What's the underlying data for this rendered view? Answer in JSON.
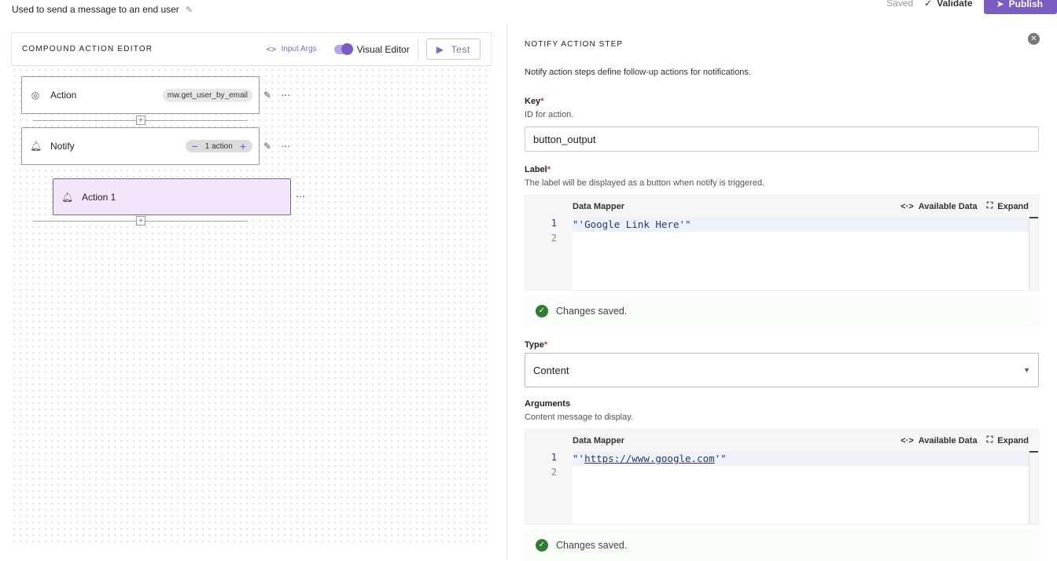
{
  "header": {
    "description": "Used to send a message to an end user",
    "saved": "Saved",
    "validate": "Validate",
    "publish": "Publish"
  },
  "editor": {
    "title": "COMPOUND ACTION EDITOR",
    "input_args": "Input Args",
    "visual_editor": "Visual Editor",
    "test": "Test",
    "nodes": [
      {
        "label": "Action",
        "chip": "mw.get_user_by_email",
        "icon": "action-icon"
      },
      {
        "label": "Notify",
        "chip": "1 action",
        "icon": "bell-icon"
      },
      {
        "label": "Action 1",
        "icon": "bell-icon"
      }
    ]
  },
  "panel": {
    "title": "NOTIFY ACTION STEP",
    "description": "Notify action steps define follow-up actions for notifications.",
    "key": {
      "label": "Key",
      "required": "*",
      "help": "ID for action.",
      "value": "button_output"
    },
    "label": {
      "label": "Label",
      "required": "*",
      "help": "The label will be displayed as a button when notify is triggered.",
      "mapper_title": "Data Mapper",
      "available_data": "Available Data",
      "expand": "Expand",
      "line1_prefix": "\"'",
      "line1_text": "Google Link Here",
      "line1_suffix": "'\"",
      "line_numbers": [
        "1",
        "2"
      ],
      "status": "Changes saved."
    },
    "type": {
      "label": "Type",
      "required": "*",
      "value": "Content"
    },
    "arguments": {
      "label": "Arguments",
      "help": "Content message to display.",
      "mapper_title": "Data Mapper",
      "available_data": "Available Data",
      "expand": "Expand",
      "line1_prefix": "\"'",
      "line1_text": "https://www.google.com",
      "line1_suffix": "'\"",
      "line_numbers": [
        "1",
        "2"
      ],
      "status": "Changes saved."
    }
  },
  "colors": {
    "accent": "#7b5cc4",
    "success": "#2e7d32",
    "child_bg": "#f3e6fb"
  }
}
